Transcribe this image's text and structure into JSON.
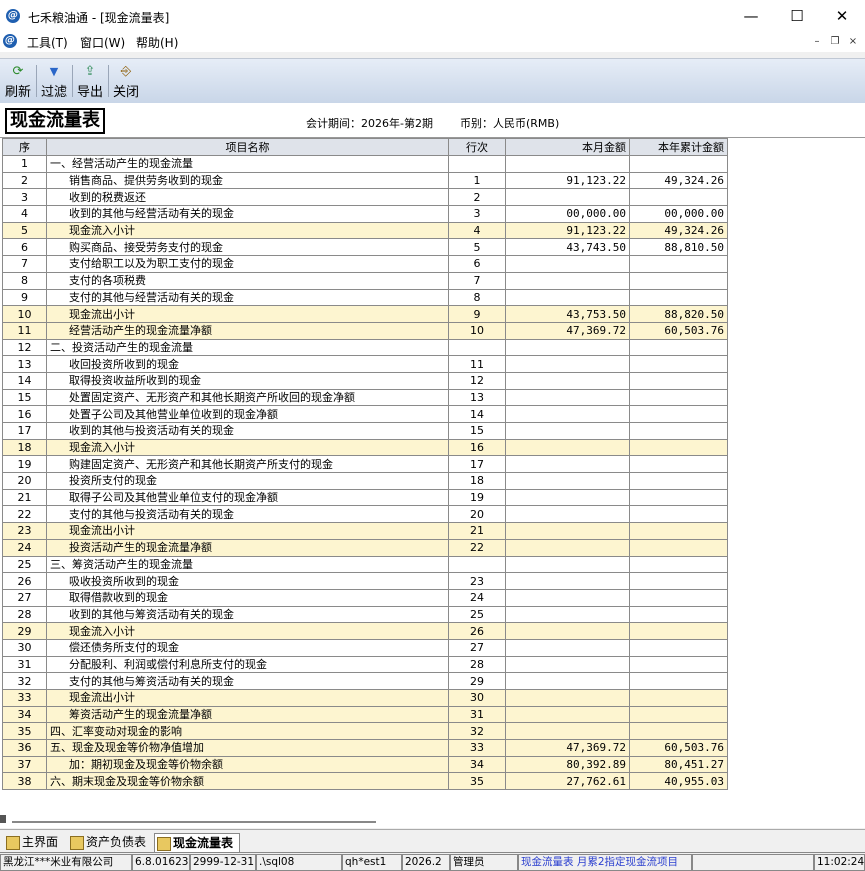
{
  "window": {
    "title": "七禾粮油通 - [现金流量表]",
    "app_icon": "@",
    "controls": {
      "minimize": "—",
      "maximize": "☐",
      "close": "✕"
    }
  },
  "menubar": {
    "items": [
      "工具(T)",
      "窗口(W)",
      "帮助(H)"
    ],
    "mdi_controls": {
      "minimize": "–",
      "restore": "❐",
      "close": "×"
    }
  },
  "toolbar": {
    "buttons": [
      {
        "label": "刷新",
        "icon": "refresh-icon",
        "glyph": "⟳"
      },
      {
        "label": "过滤",
        "icon": "filter-icon",
        "glyph": "▼"
      },
      {
        "label": "导出",
        "icon": "export-icon",
        "glyph": "⇪"
      },
      {
        "label": "关闭",
        "icon": "close-door-icon",
        "glyph": "⎆"
      }
    ]
  },
  "report": {
    "title": "现金流量表",
    "period": "会计期间：2026年-第2期",
    "currency": "币别：人民币(RMB)"
  },
  "table": {
    "headers": {
      "seq": "序",
      "name": "项目名称",
      "line": "行次",
      "month": "本月金额",
      "ytd": "本年累计金额"
    },
    "rows": [
      {
        "seq": "1",
        "name": "一、经营活动产生的现金流量",
        "line": "",
        "month": "",
        "ytd": "",
        "level": 0,
        "sub": false
      },
      {
        "seq": "2",
        "name": "销售商品、提供劳务收到的现金",
        "line": "1",
        "month": "91,123.22",
        "ytd": "49,324.26",
        "level": 1,
        "sub": false
      },
      {
        "seq": "3",
        "name": "收到的税费返还",
        "line": "2",
        "month": "",
        "ytd": "",
        "level": 1,
        "sub": false
      },
      {
        "seq": "4",
        "name": "收到的其他与经营活动有关的现金",
        "line": "3",
        "month": "00,000.00",
        "ytd": "00,000.00",
        "level": 1,
        "sub": false
      },
      {
        "seq": "5",
        "name": "现金流入小计",
        "line": "4",
        "month": "91,123.22",
        "ytd": "49,324.26",
        "level": 2,
        "sub": true
      },
      {
        "seq": "6",
        "name": "购买商品、接受劳务支付的现金",
        "line": "5",
        "month": "43,743.50",
        "ytd": "88,810.50",
        "level": 1,
        "sub": false
      },
      {
        "seq": "7",
        "name": "支付给职工以及为职工支付的现金",
        "line": "6",
        "month": "",
        "ytd": "",
        "level": 1,
        "sub": false
      },
      {
        "seq": "8",
        "name": "支付的各项税费",
        "line": "7",
        "month": "",
        "ytd": "",
        "level": 1,
        "sub": false
      },
      {
        "seq": "9",
        "name": "支付的其他与经营活动有关的现金",
        "line": "8",
        "month": "",
        "ytd": "",
        "level": 1,
        "sub": false
      },
      {
        "seq": "10",
        "name": "现金流出小计",
        "line": "9",
        "month": "43,753.50",
        "ytd": "88,820.50",
        "level": 2,
        "sub": true
      },
      {
        "seq": "11",
        "name": "经营活动产生的现金流量净额",
        "line": "10",
        "month": "47,369.72",
        "ytd": "60,503.76",
        "level": 2,
        "sub": true
      },
      {
        "seq": "12",
        "name": "二、投资活动产生的现金流量",
        "line": "",
        "month": "",
        "ytd": "",
        "level": 0,
        "sub": false
      },
      {
        "seq": "13",
        "name": "收回投资所收到的现金",
        "line": "11",
        "month": "",
        "ytd": "",
        "level": 1,
        "sub": false
      },
      {
        "seq": "14",
        "name": "取得投资收益所收到的现金",
        "line": "12",
        "month": "",
        "ytd": "",
        "level": 1,
        "sub": false
      },
      {
        "seq": "15",
        "name": "处置固定资产、无形资产和其他长期资产所收回的现金净额",
        "line": "13",
        "month": "",
        "ytd": "",
        "level": 1,
        "sub": false
      },
      {
        "seq": "16",
        "name": "处置子公司及其他营业单位收到的现金净额",
        "line": "14",
        "month": "",
        "ytd": "",
        "level": 1,
        "sub": false
      },
      {
        "seq": "17",
        "name": "收到的其他与投资活动有关的现金",
        "line": "15",
        "month": "",
        "ytd": "",
        "level": 1,
        "sub": false
      },
      {
        "seq": "18",
        "name": "现金流入小计",
        "line": "16",
        "month": "",
        "ytd": "",
        "level": 2,
        "sub": true
      },
      {
        "seq": "19",
        "name": "购建固定资产、无形资产和其他长期资产所支付的现金",
        "line": "17",
        "month": "",
        "ytd": "",
        "level": 1,
        "sub": false
      },
      {
        "seq": "20",
        "name": "投资所支付的现金",
        "line": "18",
        "month": "",
        "ytd": "",
        "level": 1,
        "sub": false
      },
      {
        "seq": "21",
        "name": "取得子公司及其他营业单位支付的现金净额",
        "line": "19",
        "month": "",
        "ytd": "",
        "level": 1,
        "sub": false
      },
      {
        "seq": "22",
        "name": "支付的其他与投资活动有关的现金",
        "line": "20",
        "month": "",
        "ytd": "",
        "level": 1,
        "sub": false
      },
      {
        "seq": "23",
        "name": "现金流出小计",
        "line": "21",
        "month": "",
        "ytd": "",
        "level": 2,
        "sub": true
      },
      {
        "seq": "24",
        "name": "投资活动产生的现金流量净额",
        "line": "22",
        "month": "",
        "ytd": "",
        "level": 2,
        "sub": true
      },
      {
        "seq": "25",
        "name": "三、筹资活动产生的现金流量",
        "line": "",
        "month": "",
        "ytd": "",
        "level": 0,
        "sub": false
      },
      {
        "seq": "26",
        "name": "吸收投资所收到的现金",
        "line": "23",
        "month": "",
        "ytd": "",
        "level": 1,
        "sub": false
      },
      {
        "seq": "27",
        "name": "取得借款收到的现金",
        "line": "24",
        "month": "",
        "ytd": "",
        "level": 1,
        "sub": false
      },
      {
        "seq": "28",
        "name": "收到的其他与筹资活动有关的现金",
        "line": "25",
        "month": "",
        "ytd": "",
        "level": 1,
        "sub": false
      },
      {
        "seq": "29",
        "name": "现金流入小计",
        "line": "26",
        "month": "",
        "ytd": "",
        "level": 2,
        "sub": true
      },
      {
        "seq": "30",
        "name": "偿还债务所支付的现金",
        "line": "27",
        "month": "",
        "ytd": "",
        "level": 1,
        "sub": false
      },
      {
        "seq": "31",
        "name": "分配股利、利润或偿付利息所支付的现金",
        "line": "28",
        "month": "",
        "ytd": "",
        "level": 1,
        "sub": false
      },
      {
        "seq": "32",
        "name": "支付的其他与筹资活动有关的现金",
        "line": "29",
        "month": "",
        "ytd": "",
        "level": 1,
        "sub": false
      },
      {
        "seq": "33",
        "name": "现金流出小计",
        "line": "30",
        "month": "",
        "ytd": "",
        "level": 2,
        "sub": true
      },
      {
        "seq": "34",
        "name": "筹资活动产生的现金流量净额",
        "line": "31",
        "month": "",
        "ytd": "",
        "level": 2,
        "sub": true
      },
      {
        "seq": "35",
        "name": "四、汇率变动对现金的影响",
        "line": "32",
        "month": "",
        "ytd": "",
        "level": 0,
        "sub": true
      },
      {
        "seq": "36",
        "name": "五、现金及现金等价物净值增加",
        "line": "33",
        "month": "47,369.72",
        "ytd": "60,503.76",
        "level": 0,
        "sub": true
      },
      {
        "seq": "37",
        "name": "加：期初现金及现金等价物余额",
        "line": "34",
        "month": "80,392.89",
        "ytd": "80,451.27",
        "level": 2,
        "sub": true
      },
      {
        "seq": "38",
        "name": "六、期末现金及现金等价物余额",
        "line": "35",
        "month": "27,762.61",
        "ytd": "40,955.03",
        "level": 0,
        "sub": true
      }
    ]
  },
  "tabs": [
    {
      "label": "主界面",
      "active": false
    },
    {
      "label": "资产负债表",
      "active": false
    },
    {
      "label": "现金流量表",
      "active": true
    }
  ],
  "statusbar": {
    "company": "黑龙江***米业有限公司",
    "version": "6.8.01623",
    "date": "2999-12-31",
    "server": ".\\sql08",
    "account": "qh*est1",
    "period": "2026.2",
    "user": "管理员",
    "message": "现金流量表 月累2指定现金流项目",
    "blank": "",
    "time": "11:02:24"
  }
}
